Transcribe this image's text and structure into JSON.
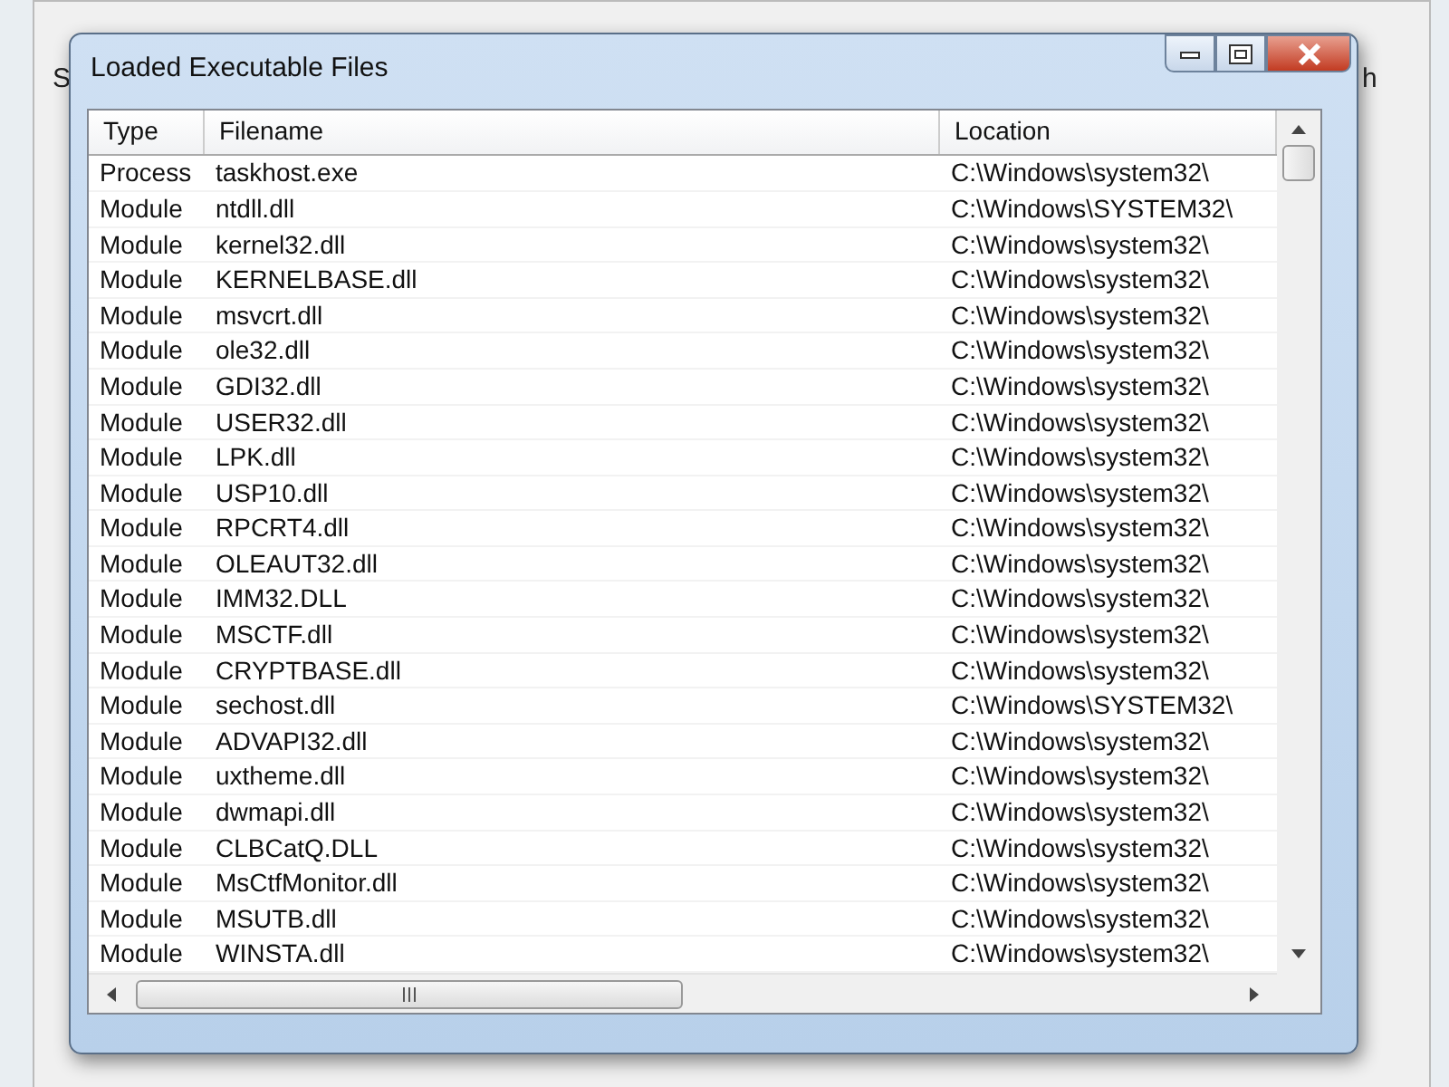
{
  "background_window": {
    "fragments": [
      "S",
      "h"
    ]
  },
  "dialog": {
    "title": "Loaded Executable Files"
  },
  "table": {
    "columns": [
      "Type",
      "Filename",
      "Location"
    ],
    "rows": [
      [
        "Process",
        "taskhost.exe",
        "C:\\Windows\\system32\\"
      ],
      [
        "Module",
        "ntdll.dll",
        "C:\\Windows\\SYSTEM32\\"
      ],
      [
        "Module",
        "kernel32.dll",
        "C:\\Windows\\system32\\"
      ],
      [
        "Module",
        "KERNELBASE.dll",
        "C:\\Windows\\system32\\"
      ],
      [
        "Module",
        "msvcrt.dll",
        "C:\\Windows\\system32\\"
      ],
      [
        "Module",
        "ole32.dll",
        "C:\\Windows\\system32\\"
      ],
      [
        "Module",
        "GDI32.dll",
        "C:\\Windows\\system32\\"
      ],
      [
        "Module",
        "USER32.dll",
        "C:\\Windows\\system32\\"
      ],
      [
        "Module",
        "LPK.dll",
        "C:\\Windows\\system32\\"
      ],
      [
        "Module",
        "USP10.dll",
        "C:\\Windows\\system32\\"
      ],
      [
        "Module",
        "RPCRT4.dll",
        "C:\\Windows\\system32\\"
      ],
      [
        "Module",
        "OLEAUT32.dll",
        "C:\\Windows\\system32\\"
      ],
      [
        "Module",
        "IMM32.DLL",
        "C:\\Windows\\system32\\"
      ],
      [
        "Module",
        "MSCTF.dll",
        "C:\\Windows\\system32\\"
      ],
      [
        "Module",
        "CRYPTBASE.dll",
        "C:\\Windows\\system32\\"
      ],
      [
        "Module",
        "sechost.dll",
        "C:\\Windows\\SYSTEM32\\"
      ],
      [
        "Module",
        "ADVAPI32.dll",
        "C:\\Windows\\system32\\"
      ],
      [
        "Module",
        "uxtheme.dll",
        "C:\\Windows\\system32\\"
      ],
      [
        "Module",
        "dwmapi.dll",
        "C:\\Windows\\system32\\"
      ],
      [
        "Module",
        "CLBCatQ.DLL",
        "C:\\Windows\\system32\\"
      ],
      [
        "Module",
        "MsCtfMonitor.dll",
        "C:\\Windows\\system32\\"
      ],
      [
        "Module",
        "MSUTB.dll",
        "C:\\Windows\\system32\\"
      ],
      [
        "Module",
        "WINSTA.dll",
        "C:\\Windows\\system32\\"
      ]
    ]
  }
}
